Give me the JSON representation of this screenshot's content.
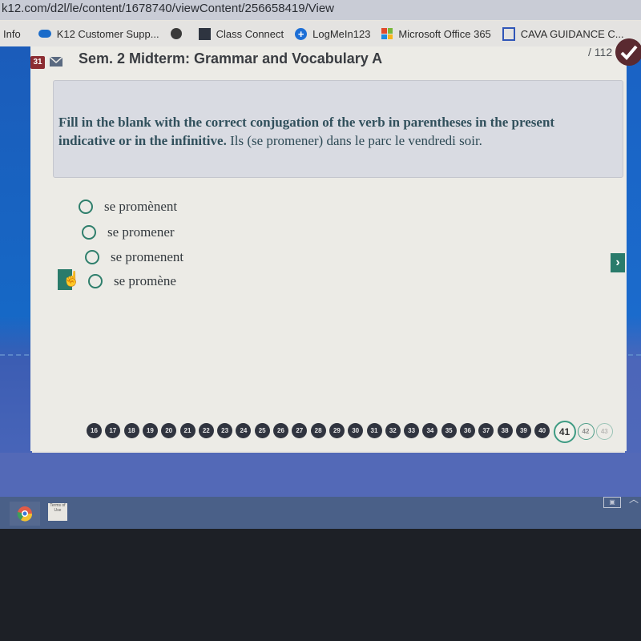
{
  "browser": {
    "url": "k12.com/d2l/le/content/1678740/viewContent/256658419/View",
    "bookmarks": [
      {
        "label": "Info",
        "icon": "none"
      },
      {
        "label": "K12 Customer Supp...",
        "icon": "salesforce-cloud-icon"
      },
      {
        "label": "",
        "icon": "globe-icon"
      },
      {
        "label": "Class Connect",
        "icon": "class-connect-icon"
      },
      {
        "label": "LogMeIn123",
        "icon": "logmein-plus-icon"
      },
      {
        "label": "Microsoft Office 365",
        "icon": "office-icon"
      },
      {
        "label": "CAVA GUIDANCE C...",
        "icon": "layout-icon"
      }
    ]
  },
  "quiz": {
    "question_number": "31",
    "title": "Sem. 2 Midterm: Grammar and Vocabulary A",
    "points": "/ 112",
    "prompt_bold": "Fill in the blank with the correct conjugation of the verb in parentheses in the present indicative or in the infinitive.",
    "prompt_text": " Ils (se promener) dans le parc le vendredi soir.",
    "options": [
      {
        "label": "se promènent",
        "selected": false
      },
      {
        "label": "se promener",
        "selected": false
      },
      {
        "label": "se promenent",
        "selected": false
      },
      {
        "label": "se promène",
        "selected": false
      }
    ],
    "next_label": "›",
    "nav": {
      "questions": [
        "16",
        "17",
        "18",
        "19",
        "20",
        "21",
        "22",
        "23",
        "24",
        "25",
        "26",
        "27",
        "28",
        "29",
        "30",
        "31",
        "32",
        "33",
        "34",
        "35",
        "36",
        "37",
        "38",
        "39",
        "40",
        "41",
        "42",
        "43"
      ],
      "answered_through": "40",
      "current": "41"
    }
  },
  "taskbar": {
    "items": [
      {
        "label": "Chrome",
        "icon": "chrome-icon"
      },
      {
        "label": "Terms of Use",
        "icon": "document-icon"
      }
    ]
  }
}
